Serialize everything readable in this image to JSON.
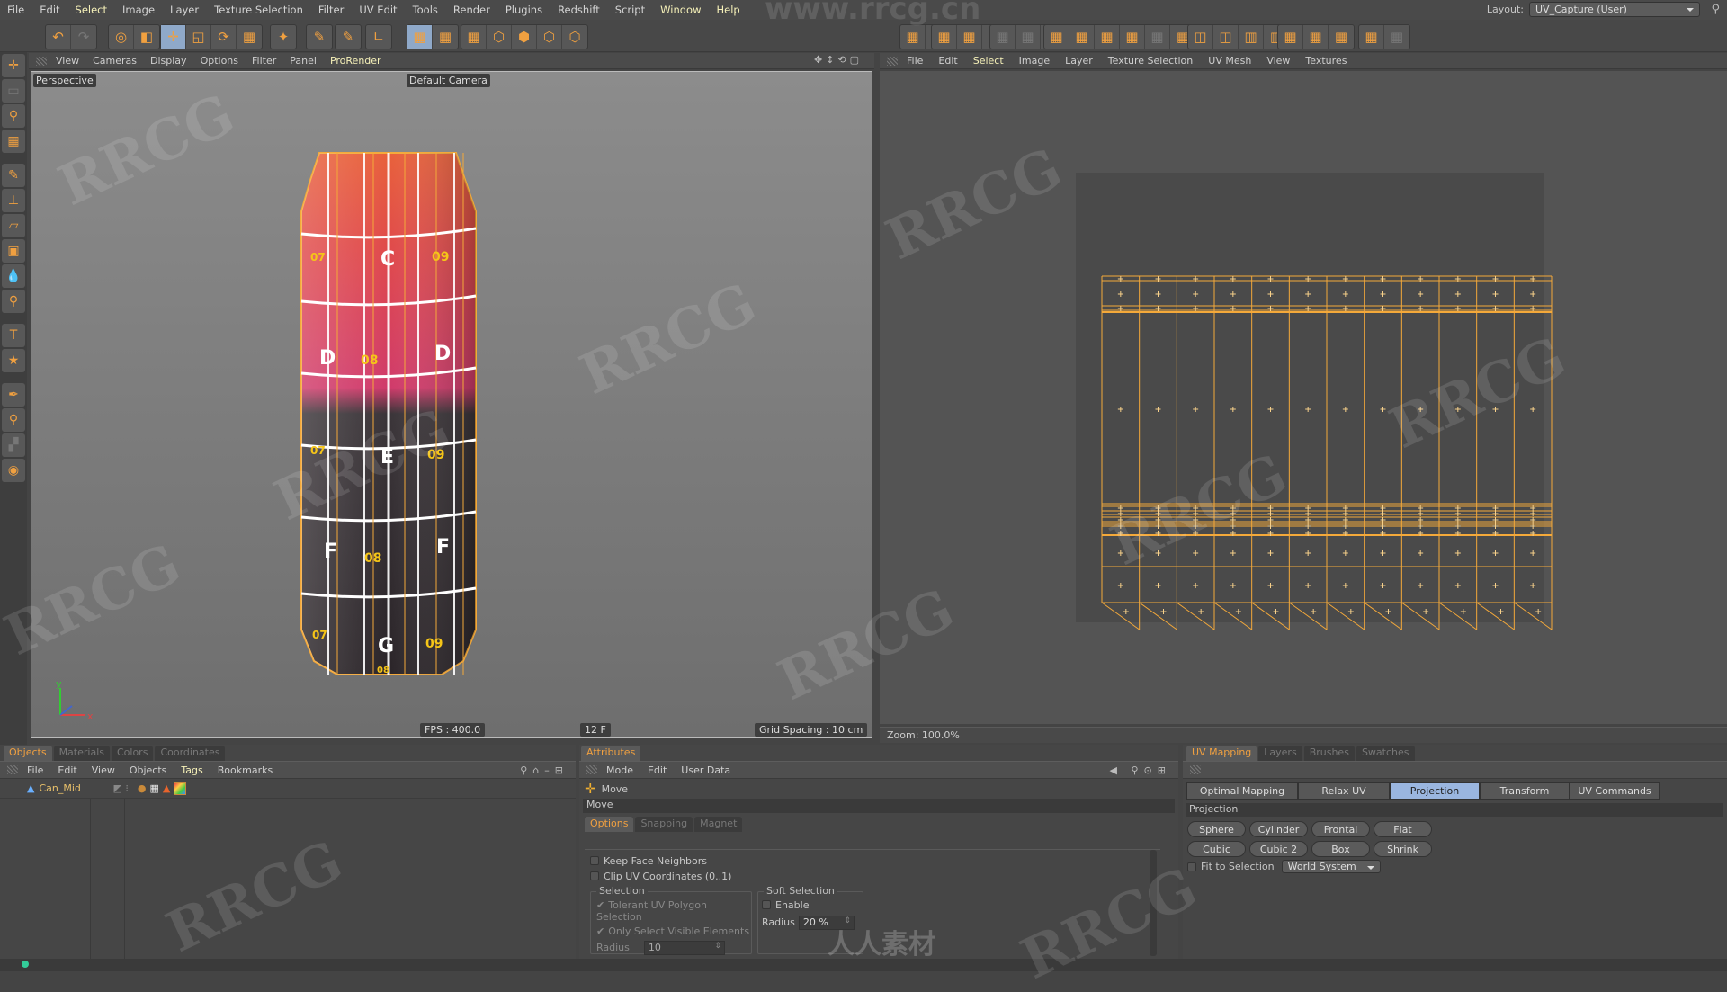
{
  "menubar": {
    "items": [
      "File",
      "Edit",
      "Select",
      "Image",
      "Layer",
      "Texture Selection",
      "Filter",
      "UV Edit",
      "Tools",
      "Render",
      "Plugins",
      "Redshift",
      "Script",
      "Window",
      "Help"
    ],
    "highlighted": [
      "Select",
      "Window",
      "Help"
    ],
    "layout_label": "Layout:",
    "layout_value": "UV_Capture (User)"
  },
  "toolbar": {
    "groups": [
      {
        "icons": [
          "undo-icon",
          "redo-icon"
        ]
      },
      {
        "icons": [
          "live-selection-icon",
          "model-mode-icon"
        ]
      },
      {
        "icons": [
          "move-icon",
          "scale-icon",
          "rotate-icon",
          "uv-magnet-icon"
        ],
        "active": "move-icon"
      },
      {
        "icons": [
          "paint-points-icon"
        ]
      },
      {
        "icons": [
          "bodypaint-3d-icon"
        ]
      },
      {
        "icons": [
          "brush-icon"
        ]
      },
      {
        "icons": [
          "axis-icon"
        ]
      },
      {
        "icons": [
          "uv-points-icon",
          "uv-polygons-icon"
        ],
        "active": "uv-points-icon"
      },
      {
        "icons": [
          "uv-mesh-icon",
          "points-mode-icon",
          "polygons-mode-icon",
          "edges-mode-icon",
          "texture-mode-icon"
        ]
      },
      {
        "icons": [
          "checker-icon",
          "checker-arrow-icon"
        ]
      },
      {
        "icons": [
          "uv-arrow-icon",
          "uv-grid-icon",
          "uv-grid2-icon"
        ]
      },
      {
        "icons": [
          "uv-disabled1-icon",
          "uv-disabled2-icon",
          "uv-copy-icon"
        ]
      },
      {
        "icons": [
          "uv-up-icon",
          "uv-down-icon",
          "uv-flip-icon",
          "uv-shrink-icon",
          "uv-disabled3-icon",
          "uv-grow-icon"
        ]
      },
      {
        "icons": [
          "align-h-icon",
          "align-v-icon",
          "dist-h-icon",
          "dist-v-icon"
        ]
      },
      {
        "icons": [
          "uv-relax-icon",
          "uv-circle-icon",
          "uv-square-icon"
        ]
      },
      {
        "icons": [
          "uv-check-icon",
          "uv-disabled4-icon"
        ]
      }
    ]
  },
  "left_tools": [
    "move-icon",
    "rectangle-select-icon",
    "lasso-select-icon",
    "checker-grid-icon",
    "brush-icon",
    "stamp-icon",
    "eraser-icon",
    "gradient-icon",
    "fill-icon",
    "magnify-icon",
    "text-icon",
    "star-icon",
    "eyedropper-icon",
    "zoom-checker-icon",
    "disabled-tool-icon",
    "circle-tool-icon"
  ],
  "viewport": {
    "menu": [
      "View",
      "Cameras",
      "Display",
      "Options",
      "Filter",
      "Panel",
      "ProRender"
    ],
    "highlighted": "ProRender",
    "view_name": "Perspective",
    "camera": "Default Camera",
    "fps": "FPS : 400.0",
    "frame": "12 F",
    "grid_spacing": "Grid Spacing : 10 cm",
    "axis_labels": {
      "y": "y",
      "x": "x"
    },
    "model_labels": {
      "row_c": [
        "07",
        "C",
        "09"
      ],
      "row_d": [
        "D",
        "08",
        "D"
      ],
      "row_e": [
        "07",
        "E",
        "09"
      ],
      "row_f": [
        "F",
        "08",
        "F"
      ],
      "row_g": [
        "07",
        "G",
        "09"
      ],
      "bottom": "08"
    }
  },
  "uv_editor": {
    "menu": [
      "File",
      "Edit",
      "Select",
      "Image",
      "Layer",
      "Texture Selection",
      "UV Mesh",
      "View",
      "Textures"
    ],
    "highlighted": "Select",
    "zoom": "Zoom: 100.0%",
    "columns": 12,
    "wire_color": "#f4a93a"
  },
  "objects_panel": {
    "tabs": [
      "Objects",
      "Materials",
      "Colors",
      "Coordinates"
    ],
    "active_tab": "Objects",
    "menu": [
      "File",
      "Edit",
      "View",
      "Objects",
      "Tags",
      "Bookmarks"
    ],
    "highlighted": "Tags",
    "objects": [
      {
        "name": "Can_Mid",
        "tags": [
          "phong-tag-icon",
          "checker-material-tag-icon",
          "uv-tag-icon",
          "texture-tag-icon"
        ]
      }
    ]
  },
  "attributes_panel": {
    "tabs": [
      "Attributes"
    ],
    "menu": [
      "Mode",
      "Edit",
      "User Data"
    ],
    "tool_name": "Move",
    "section": "Move",
    "subtabs": [
      "Options",
      "Snapping",
      "Magnet"
    ],
    "active_subtab": "Options",
    "options": [
      {
        "label": "Keep Face Neighbors",
        "checked": false
      },
      {
        "label": "Clip UV Coordinates (0..1)",
        "checked": false
      }
    ],
    "selection": {
      "title": "Selection",
      "items": [
        {
          "label": "Tolerant UV Polygon Selection",
          "checked": true
        },
        {
          "label": "Only Select Visible Elements",
          "checked": true
        }
      ],
      "radius_label": "Radius",
      "radius_value": "10"
    },
    "soft_selection": {
      "title": "Soft Selection",
      "enable_label": "Enable",
      "enabled": false,
      "radius_label": "Radius",
      "radius_value": "20 %"
    }
  },
  "uv_panel": {
    "tabs": [
      "UV Mapping",
      "Layers",
      "Brushes",
      "Swatches"
    ],
    "active_tab": "UV Mapping",
    "subtabs": [
      "Optimal Mapping",
      "Relax UV",
      "Projection",
      "Transform",
      "UV Commands"
    ],
    "active_subtab": "Projection",
    "section": "Projection",
    "buttons_row1": [
      "Sphere",
      "Cylinder",
      "Frontal",
      "Flat"
    ],
    "buttons_row2": [
      "Cubic",
      "Cubic 2",
      "Box",
      "Shrink"
    ],
    "fit_label": "Fit to Selection",
    "fit_checked": false,
    "system_value": "World System"
  },
  "watermarks": {
    "site": "www.rrcg.cn",
    "brand": "RRCG",
    "cn": "人人素材"
  }
}
